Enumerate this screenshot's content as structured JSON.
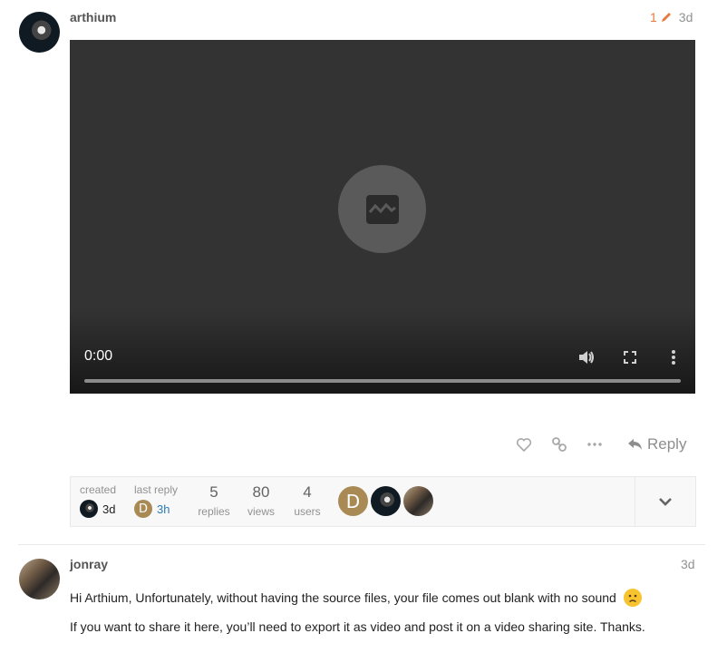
{
  "post1": {
    "username": "arthium",
    "edit_count": "1",
    "time": "3d",
    "video": {
      "time": "0:00"
    },
    "actions": {
      "reply_label": "Reply"
    }
  },
  "topic_map": {
    "created_label": "created",
    "created_time": "3d",
    "last_reply_label": "last reply",
    "last_reply_letter": "D",
    "last_reply_time": "3h",
    "replies_count": "5",
    "replies_label": "replies",
    "views_count": "80",
    "views_label": "views",
    "users_count": "4",
    "users_label": "users",
    "participant_letter": "D"
  },
  "post2": {
    "username": "jonray",
    "time": "3d",
    "line1": "Hi Arthium, Unfortunately, without having the source files, your file comes out blank with no sound",
    "line2": "If you want to share it here, you’ll need to export it as video and post it on a video sharing site. Thanks."
  },
  "colors": {
    "edit_accent": "#e67a3c",
    "link_blue": "#2a7ab8",
    "letter_avatar": "#a98a55"
  }
}
